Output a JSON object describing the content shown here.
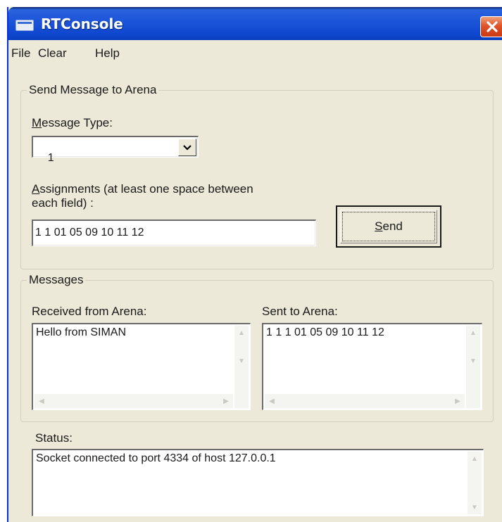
{
  "window": {
    "title": "RTConsole"
  },
  "menu": {
    "items": [
      "File",
      "Clear",
      "Help"
    ]
  },
  "send_group": {
    "title": "Send Message to Arena",
    "message_type_label_accel": "M",
    "message_type_label_rest": "essage Type:",
    "message_type_value": "1",
    "assignments_label_accel": "A",
    "assignments_label_line1_rest": "ssignments (at least one space between",
    "assignments_label_line2": "each field) :",
    "assignments_value": "1 1 01 05 09 10 11 12",
    "send_accel": "S",
    "send_rest": "end"
  },
  "messages_group": {
    "title": "Messages",
    "received_label": "Received from Arena:",
    "received_text": "Hello from SIMAN",
    "sent_label": "Sent to Arena:",
    "sent_text": "1 1 1 01 05 09 10 11 12"
  },
  "status": {
    "label": "Status:",
    "text": "Socket connected to port 4334 of host 127.0.0.1"
  },
  "colors": {
    "titlebar": "#1b54d8",
    "window_bg": "#ece9d8",
    "close_button": "#e0522a"
  },
  "icons": {
    "app": "window-icon",
    "close": "close-icon",
    "dropdown": "chevron-down-icon"
  }
}
